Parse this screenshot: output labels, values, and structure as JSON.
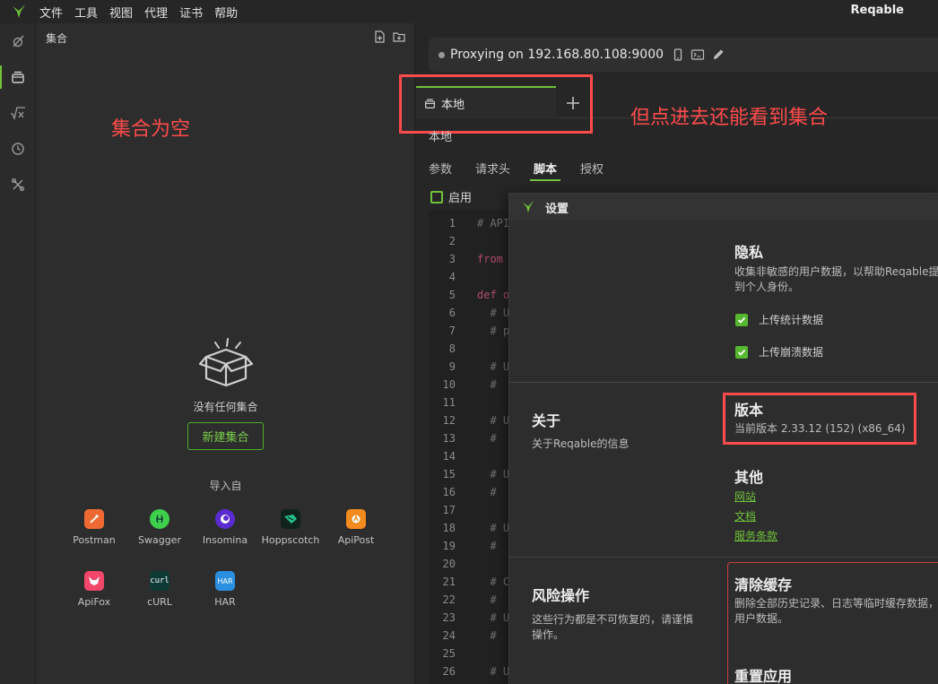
{
  "app": {
    "title": "Reqable"
  },
  "menu": [
    "文件",
    "工具",
    "视图",
    "代理",
    "证书",
    "帮助"
  ],
  "rail": [
    {
      "icon": "capture-icon"
    },
    {
      "icon": "collection-icon"
    },
    {
      "icon": "script-function-icon"
    },
    {
      "icon": "history-icon"
    },
    {
      "icon": "tools-icon"
    }
  ],
  "collections": {
    "title": "集合",
    "empty_text": "没有任何集合",
    "new_button": "新建集合",
    "import_label": "导入自",
    "importers": [
      "Postman",
      "Swagger",
      "Insomina",
      "Hoppscotch",
      "ApiPost",
      "ApiFox",
      "cURL",
      "HAR"
    ],
    "importer_badges": {
      "curl": "curl",
      "har": "HAR"
    }
  },
  "annotations": {
    "left": "集合为空",
    "right": "但点进去还能看到集合"
  },
  "proxy": {
    "text": "Proxying on 192.168.80.108:9000"
  },
  "tabs": {
    "local": "本地"
  },
  "breadcrumb": "本地",
  "subtabs": [
    "参数",
    "请求头",
    "脚本",
    "授权"
  ],
  "enable_label": "启用",
  "editor": {
    "lines": [
      {
        "n": "1",
        "t": "# API"
      },
      {
        "n": "2",
        "t": ""
      },
      {
        "n": "3",
        "t": "from",
        "kw": true
      },
      {
        "n": "4",
        "t": ""
      },
      {
        "n": "5",
        "t": "def o",
        "kw": true
      },
      {
        "n": "6",
        "t": "  # U"
      },
      {
        "n": "7",
        "t": "  # p"
      },
      {
        "n": "8",
        "t": ""
      },
      {
        "n": "9",
        "t": "  # U"
      },
      {
        "n": "10",
        "t": "  #"
      },
      {
        "n": "11",
        "t": ""
      },
      {
        "n": "12",
        "t": "  # U"
      },
      {
        "n": "13",
        "t": "  #"
      },
      {
        "n": "14",
        "t": ""
      },
      {
        "n": "15",
        "t": "  # U"
      },
      {
        "n": "16",
        "t": "  #"
      },
      {
        "n": "17",
        "t": ""
      },
      {
        "n": "18",
        "t": "  # U"
      },
      {
        "n": "19",
        "t": "  #"
      },
      {
        "n": "20",
        "t": ""
      },
      {
        "n": "21",
        "t": "  # C"
      },
      {
        "n": "22",
        "t": "  #"
      },
      {
        "n": "23",
        "t": "  # U"
      },
      {
        "n": "24",
        "t": "  #"
      },
      {
        "n": "25",
        "t": ""
      },
      {
        "n": "26",
        "t": "  # U"
      }
    ]
  },
  "settings": {
    "title": "设置",
    "privacy": {
      "heading": "隐私",
      "desc_l1": "收集非敏感的用户数据，以帮助Reqable提",
      "desc_l2": "到个人身份。",
      "opt1": "上传统计数据",
      "opt2": "上传崩溃数据"
    },
    "about": {
      "heading": "关于",
      "desc": "关于Reqable的信息",
      "version_heading": "版本",
      "version_text": "当前版本 2.33.12 (152) (x86_64)",
      "other_heading": "其他",
      "links": [
        "网站",
        "文档",
        "服务条款"
      ]
    },
    "danger": {
      "heading": "风险操作",
      "desc_l1": "这些行为都是不可恢复的，请谨慎",
      "desc_l2": "操作。",
      "clear_heading": "清除缓存",
      "clear_l1": "删除全部历史记录、日志等临时缓存数据，",
      "clear_l2": "用户数据。",
      "reset_heading": "重置应用"
    }
  },
  "colors": {
    "accent": "#6fc23a",
    "annotation": "#ff4b4b"
  }
}
